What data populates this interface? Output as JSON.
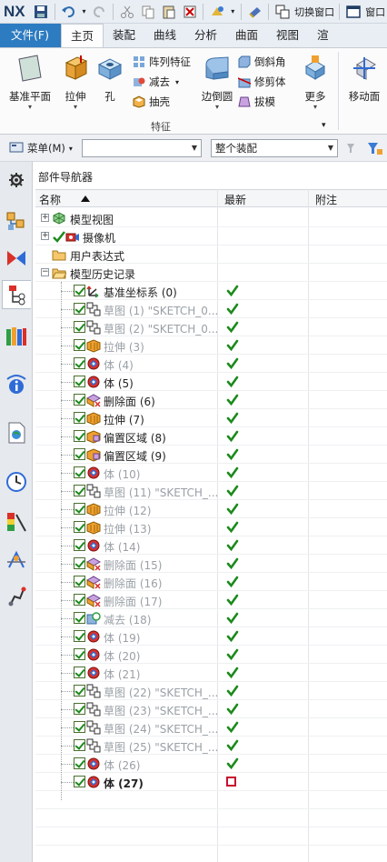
{
  "app": {
    "logo": "NX",
    "quick_access": {
      "switch_window_label": "切换窗口",
      "window_label": "窗口"
    }
  },
  "ribbon_tabs": [
    {
      "label": "文件(F)"
    },
    {
      "label": "主页"
    },
    {
      "label": "装配"
    },
    {
      "label": "曲线"
    },
    {
      "label": "分析"
    },
    {
      "label": "曲面"
    },
    {
      "label": "视图"
    },
    {
      "label": "渲"
    }
  ],
  "ribbon": {
    "datum_plane": "基准平面",
    "extrude": "拉伸",
    "hole": "孔",
    "pattern_feature": "阵列特征",
    "subtract": "减去",
    "shell": "抽壳",
    "edge_blend": "边倒圆",
    "chamfer": "倒斜角",
    "trim_body": "修剪体",
    "draft": "拔模",
    "more": "更多",
    "move_face": "移动面",
    "group_label": "特征"
  },
  "filterbar": {
    "menu_label": "菜单(M)",
    "filter_value": "",
    "assembly_scope": "整个装配"
  },
  "navigator": {
    "title": "部件导航器",
    "columns": {
      "name": "名称",
      "updated": "最新",
      "comment": "附注"
    },
    "top_nodes": [
      {
        "label": "模型视图"
      },
      {
        "label": "摄像机"
      },
      {
        "label": "用户表达式"
      },
      {
        "label": "模型历史记录"
      }
    ],
    "history": [
      {
        "label": "基准坐标系 (0)",
        "icon": "datum-csys-icon",
        "dim": false,
        "status": "ok"
      },
      {
        "label": "草图 (1) \"SKETCH_0...",
        "icon": "sketch-icon",
        "dim": true,
        "status": "ok"
      },
      {
        "label": "草图 (2) \"SKETCH_0...",
        "icon": "sketch-icon",
        "dim": true,
        "status": "ok"
      },
      {
        "label": "拉伸 (3)",
        "icon": "extrude-icon",
        "dim": true,
        "status": "ok"
      },
      {
        "label": "体 (4)",
        "icon": "body-icon",
        "dim": true,
        "status": "ok"
      },
      {
        "label": "体 (5)",
        "icon": "body-icon",
        "dim": false,
        "status": "ok"
      },
      {
        "label": "删除面 (6)",
        "icon": "delete-face-icon",
        "dim": false,
        "status": "ok"
      },
      {
        "label": "拉伸 (7)",
        "icon": "extrude-icon",
        "dim": false,
        "status": "ok"
      },
      {
        "label": "偏置区域 (8)",
        "icon": "offset-region-icon",
        "dim": false,
        "status": "ok"
      },
      {
        "label": "偏置区域 (9)",
        "icon": "offset-region-icon",
        "dim": false,
        "status": "ok"
      },
      {
        "label": "体 (10)",
        "icon": "body-icon",
        "dim": true,
        "status": "ok"
      },
      {
        "label": "草图 (11) \"SKETCH_...",
        "icon": "sketch-icon",
        "dim": true,
        "status": "ok"
      },
      {
        "label": "拉伸 (12)",
        "icon": "extrude-icon",
        "dim": true,
        "status": "ok"
      },
      {
        "label": "拉伸 (13)",
        "icon": "extrude-icon",
        "dim": true,
        "status": "ok"
      },
      {
        "label": "体 (14)",
        "icon": "body-icon",
        "dim": true,
        "status": "ok"
      },
      {
        "label": "删除面 (15)",
        "icon": "delete-face-icon",
        "dim": true,
        "status": "ok"
      },
      {
        "label": "删除面 (16)",
        "icon": "delete-face-icon",
        "dim": true,
        "status": "ok"
      },
      {
        "label": "删除面 (17)",
        "icon": "delete-face-icon",
        "dim": true,
        "status": "ok"
      },
      {
        "label": "减去 (18)",
        "icon": "subtract-icon",
        "dim": true,
        "status": "ok"
      },
      {
        "label": "体 (19)",
        "icon": "body-icon",
        "dim": true,
        "status": "ok"
      },
      {
        "label": "体 (20)",
        "icon": "body-icon",
        "dim": true,
        "status": "ok"
      },
      {
        "label": "体 (21)",
        "icon": "body-icon",
        "dim": true,
        "status": "ok"
      },
      {
        "label": "草图 (22) \"SKETCH_...",
        "icon": "sketch-icon",
        "dim": true,
        "status": "ok"
      },
      {
        "label": "草图 (23) \"SKETCH_...",
        "icon": "sketch-icon",
        "dim": true,
        "status": "ok"
      },
      {
        "label": "草图 (24) \"SKETCH_...",
        "icon": "sketch-icon",
        "dim": true,
        "status": "ok"
      },
      {
        "label": "草图 (25) \"SKETCH_...",
        "icon": "sketch-icon",
        "dim": true,
        "status": "ok"
      },
      {
        "label": "体 (26)",
        "icon": "body-icon",
        "dim": true,
        "status": "ok"
      },
      {
        "label": "体 (27)",
        "icon": "body-icon",
        "dim": false,
        "bold": true,
        "status": "pending"
      }
    ]
  },
  "colors": {
    "file_tab": "#2d7bc0",
    "check_green": "#1c8a1c",
    "pending_red": "#c8102e"
  }
}
